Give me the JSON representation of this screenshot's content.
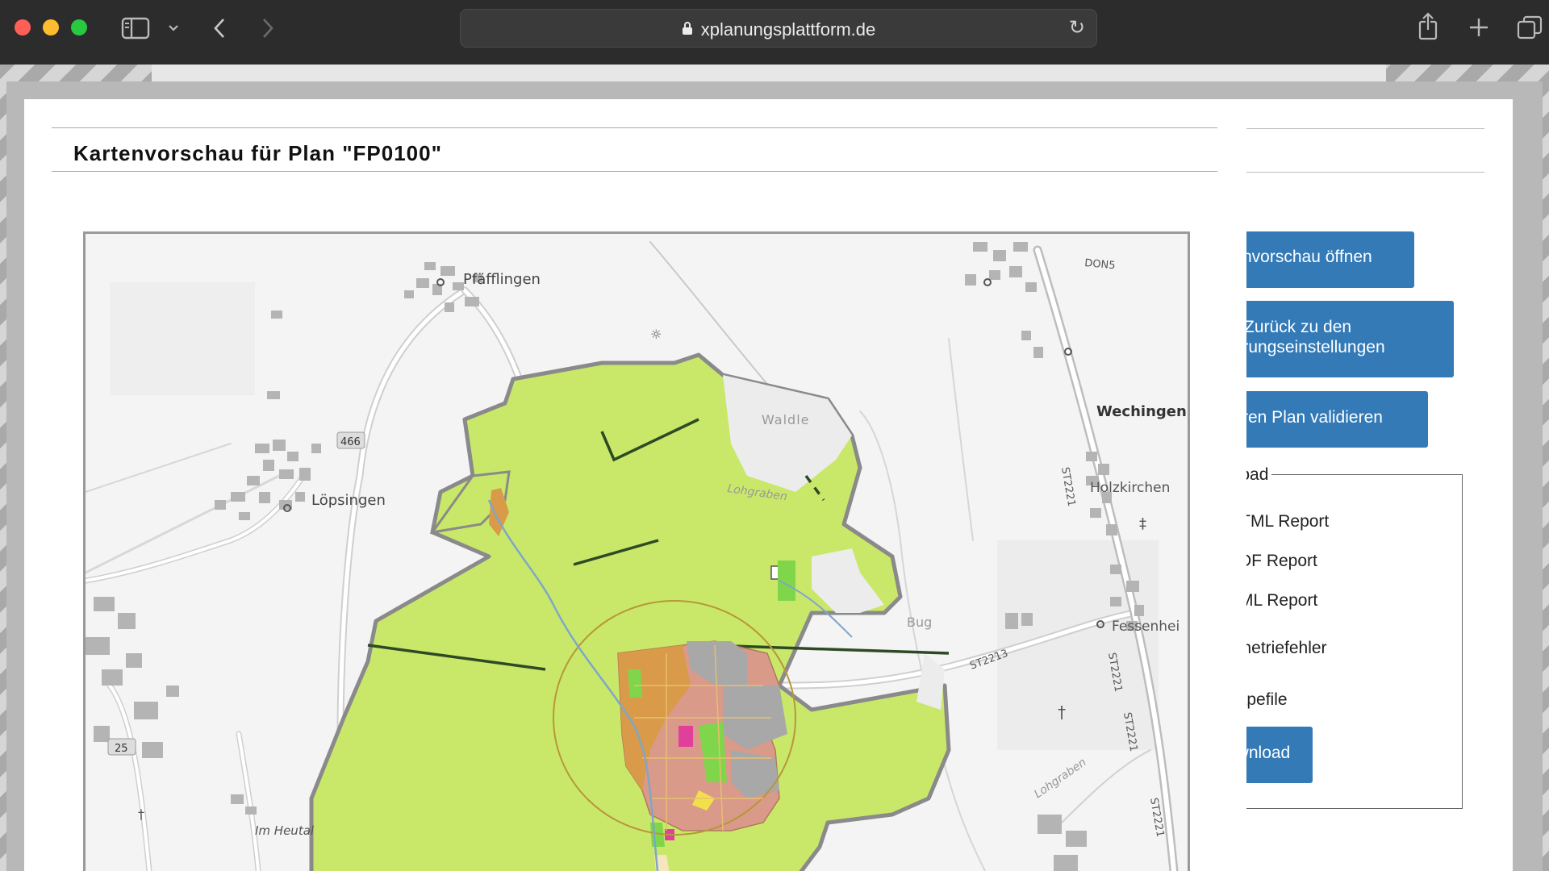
{
  "browser": {
    "url": "xplanungsplattform.de",
    "traffic_colors": {
      "close": "#fe5f57",
      "minimize": "#febc2e",
      "zoom": "#28c840"
    },
    "icons": [
      "sidebar-toggle-icon",
      "chevron-down-icon",
      "back-arrow-icon",
      "forward-arrow-icon",
      "lock-icon",
      "reload-icon",
      "share-icon",
      "new-tab-icon",
      "tabs-overview-icon"
    ]
  },
  "modal": {
    "title": "Kartenvorschau für Plan \"FP0100\""
  },
  "map": {
    "labels": {
      "pfaefflingen": "Pfäfflingen",
      "loepsingen": "Löpsingen",
      "wechingen": "Wechingen",
      "holzkirchen": "Holzkirchen",
      "fessenheim": "Fessenhei",
      "waldle": "Waldle",
      "lohgraben1": "Lohgraben",
      "lohgraben2": "Lohgraben",
      "im_heutal": "Im Heutal",
      "bug": "Bug",
      "road_466": "466",
      "road_25": "25",
      "road_dons": "DON5",
      "road_st2213": "ST2213",
      "road_st2221a": "ST2221",
      "road_st2221b": "ST2221",
      "road_st2221c": "ST2221",
      "road_st2221d": "ST2221"
    },
    "colors": {
      "plan_green": "#c9e86a",
      "orange": "#d99a4a",
      "rose": "#d99a8a",
      "grey_block": "#a8a8a8",
      "bright_green": "#7fd64a",
      "pink": "#e0409a",
      "yellow": "#f2e04a",
      "outline": "#8a8a8a"
    }
  },
  "side_panel": {
    "buttons": {
      "open_preview": "nvorschau öffnen",
      "back_line1": "Zurück zu den",
      "back_line2": "ierungseinstellungen",
      "validate": "ren Plan validieren",
      "download": "ownload"
    },
    "download_legend": "nload",
    "download_items": [
      "HTML Report",
      "PDF Report",
      "XML Report",
      "ometriefehler",
      "hapefile"
    ]
  }
}
